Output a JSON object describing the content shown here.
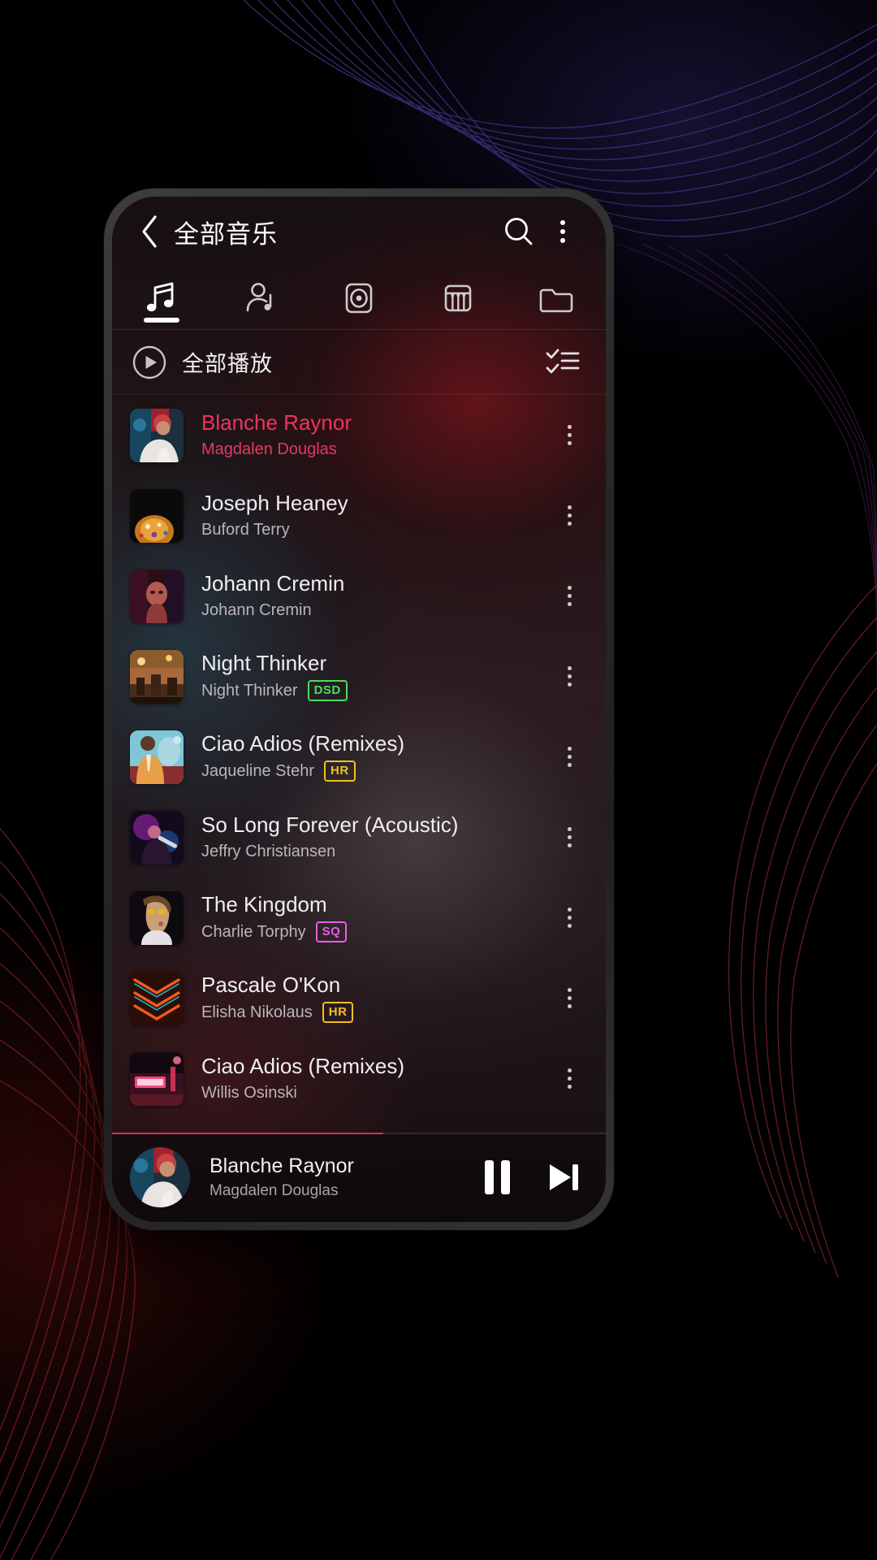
{
  "header": {
    "back_icon": "chevron-left-icon",
    "title": "全部音乐",
    "search_icon": "search-icon",
    "overflow_icon": "kebab-menu-icon"
  },
  "tabs": [
    {
      "id": "songs",
      "icon": "music-notes-icon",
      "active": true
    },
    {
      "id": "artists",
      "icon": "artist-icon",
      "active": false
    },
    {
      "id": "albums",
      "icon": "album-disc-icon",
      "active": false
    },
    {
      "id": "genres",
      "icon": "piano-keys-icon",
      "active": false
    },
    {
      "id": "folders",
      "icon": "folder-icon",
      "active": false
    }
  ],
  "playall": {
    "icon": "play-circle-icon",
    "label": "全部播放",
    "multiselect_icon": "checklist-icon"
  },
  "songs": [
    {
      "title": "Blanche Raynor",
      "artist": "Magdalen Douglas",
      "badge": "",
      "playing": true,
      "art": "a"
    },
    {
      "title": "Joseph Heaney",
      "artist": "Buford Terry",
      "badge": "",
      "playing": false,
      "art": "b"
    },
    {
      "title": "Johann Cremin",
      "artist": "Johann Cremin",
      "badge": "",
      "playing": false,
      "art": "c"
    },
    {
      "title": "Night Thinker",
      "artist": "Night Thinker",
      "badge": "DSD",
      "playing": false,
      "art": "d"
    },
    {
      "title": "Ciao Adios (Remixes)",
      "artist": "Jaqueline Stehr",
      "badge": "HR",
      "playing": false,
      "art": "e"
    },
    {
      "title": "So Long Forever (Acoustic)",
      "artist": "Jeffry Christiansen",
      "badge": "",
      "playing": false,
      "art": "f"
    },
    {
      "title": "The Kingdom",
      "artist": "Charlie Torphy",
      "badge": "SQ",
      "playing": false,
      "art": "g"
    },
    {
      "title": "Pascale O'Kon",
      "artist": "Elisha Nikolaus",
      "badge": "HR",
      "playing": false,
      "art": "h"
    },
    {
      "title": "Ciao Adios (Remixes)",
      "artist": "Willis Osinski",
      "badge": "",
      "playing": false,
      "art": "i"
    }
  ],
  "player": {
    "title": "Blanche Raynor",
    "artist": "Magdalen Douglas",
    "pause_icon": "pause-icon",
    "next_icon": "skip-next-icon",
    "progress_percent": 55
  },
  "colors": {
    "accent": "#f0335f",
    "progress": "#d9304f",
    "badge_dsd": "#4bdc5a",
    "badge_hr": "#f0c020",
    "badge_sq": "#e85ce8"
  }
}
